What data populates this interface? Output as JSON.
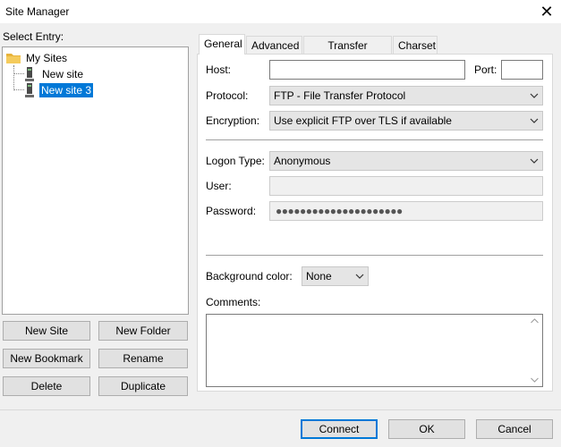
{
  "window": {
    "title": "Site Manager"
  },
  "left": {
    "select_entry_label": "Select Entry:",
    "tree": {
      "root": "My Sites",
      "items": [
        "New site",
        "New site 3"
      ],
      "selected_index": 1
    },
    "buttons": {
      "new_site": "New Site",
      "new_folder": "New Folder",
      "new_bookmark": "New Bookmark",
      "rename": "Rename",
      "delete": "Delete",
      "duplicate": "Duplicate"
    }
  },
  "tabs": [
    "General",
    "Advanced",
    "Transfer Settings",
    "Charset"
  ],
  "general": {
    "host_label": "Host:",
    "host_value": "",
    "port_label": "Port:",
    "port_value": "",
    "protocol_label": "Protocol:",
    "protocol_value": "FTP - File Transfer Protocol",
    "encryption_label": "Encryption:",
    "encryption_value": "Use explicit FTP over TLS if available",
    "logon_type_label": "Logon Type:",
    "logon_type_value": "Anonymous",
    "user_label": "User:",
    "user_value": "",
    "password_label": "Password:",
    "password_value": "●●●●●●●●●●●●●●●●●●●●●",
    "bg_color_label": "Background color:",
    "bg_color_value": "None",
    "comments_label": "Comments:",
    "comments_value": ""
  },
  "footer": {
    "connect": "Connect",
    "ok": "OK",
    "cancel": "Cancel"
  },
  "colors": {
    "accent": "#0078d7",
    "folder": "#e8b33a"
  }
}
